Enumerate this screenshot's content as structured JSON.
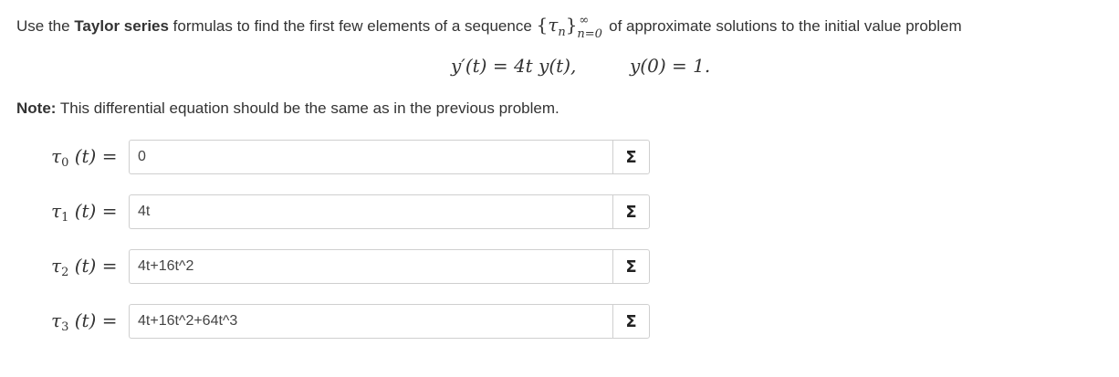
{
  "intro": {
    "prefix": "Use the ",
    "bold": "Taylor series",
    "middle": " formulas to find the first few elements of a sequence ",
    "seq_open": "{",
    "seq_symbol": "τ",
    "seq_sub": "n",
    "seq_close": "}",
    "seq_sup": "∞",
    "seq_lower": "n=0",
    "suffix": " of approximate solutions to the initial value problem"
  },
  "equation": {
    "left": "y′(t) = 4t y(t),",
    "right": "y(0) = 1."
  },
  "note": {
    "label": "Note:",
    "text": " This differential equation should be the same as in the previous problem."
  },
  "rows": [
    {
      "symbol": "τ",
      "sub": "0",
      "tail": "(t) =",
      "value": "0"
    },
    {
      "symbol": "τ",
      "sub": "1",
      "tail": "(t) =",
      "value": "4t"
    },
    {
      "symbol": "τ",
      "sub": "2",
      "tail": "(t) =",
      "value": "4t+16t^2"
    },
    {
      "symbol": "τ",
      "sub": "3",
      "tail": "(t) =",
      "value": "4t+16t^2+64t^3"
    }
  ],
  "sigma_label": "Σ"
}
